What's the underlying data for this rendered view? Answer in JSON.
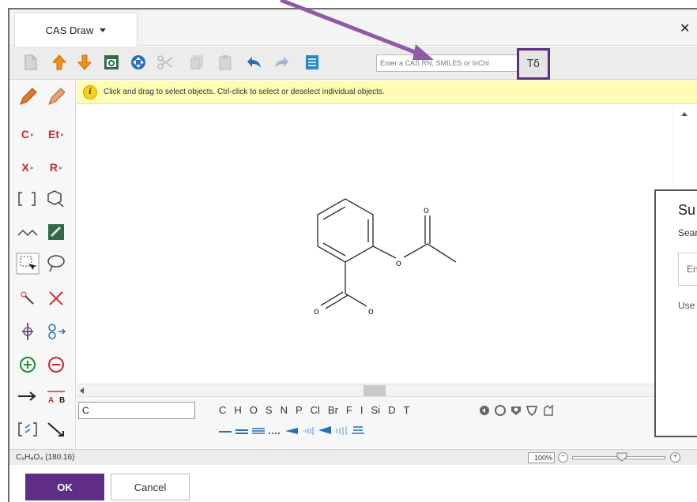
{
  "tab": {
    "label": "CAS Draw"
  },
  "toolbar": {
    "search_placeholder": "Enter a CAS RN, SMILES or InChI",
    "structure_button_label": "Tδ"
  },
  "palette": {
    "carbon": "C",
    "ethyl": "Et",
    "halogen": "X",
    "rgroup": "R"
  },
  "message": "Click and drag to select objects. Ctrl-click to select or deselect individual objects.",
  "molecule": {
    "atom_labels": [
      "o",
      "o",
      "o",
      "o"
    ]
  },
  "element_bar": {
    "current_value": "C",
    "elements": [
      "C",
      "H",
      "O",
      "S",
      "N",
      "P",
      "Cl",
      "Br",
      "F",
      "I",
      "Si",
      "D",
      "T"
    ]
  },
  "status": {
    "formula": "C₉H₈O₄ (180.16)",
    "zoom": "100%"
  },
  "footer": {
    "ok": "OK",
    "cancel": "Cancel"
  },
  "side_panel": {
    "title": "Su",
    "subtitle": "Sear",
    "input_placeholder": "En",
    "use_text": "Use"
  },
  "colors": {
    "accent": "#5e2e86",
    "arrow": "#8e5aa8",
    "message_bg": "#fffdb5",
    "palette_red": "#cc2a2a"
  }
}
